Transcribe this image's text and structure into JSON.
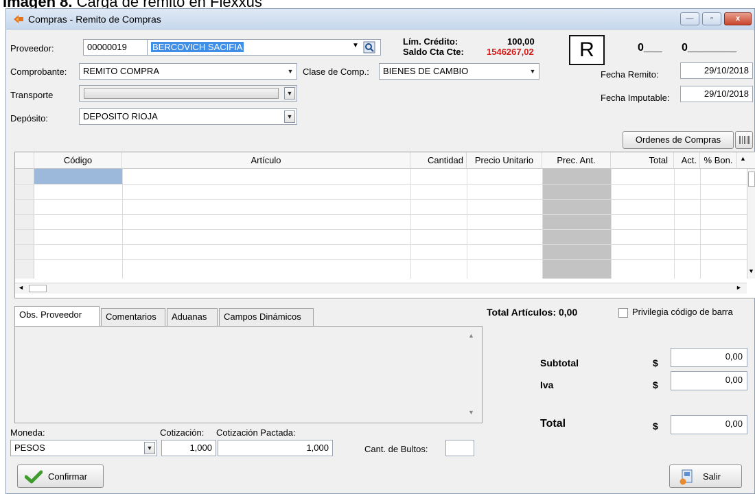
{
  "caption": {
    "bold": "Imagen 8.",
    "rest": " Carga de remito en Flexxus"
  },
  "window": {
    "title": "Compras - Remito de Compras",
    "btn_min": "—",
    "btn_max": "▫",
    "btn_close": "x"
  },
  "header": {
    "proveedor_label": "Proveedor:",
    "proveedor_code": "00000019",
    "proveedor_name": "BERCOVICH SACIFIA",
    "lim_credito_label": "Lím. Crédito:",
    "lim_credito_value": "100,00",
    "saldo_label": "Saldo Cta Cte:",
    "saldo_value": "1546267,02",
    "letter": "R",
    "num1": "0___",
    "num2": "0________",
    "comprobante_label": "Comprobante:",
    "comprobante_value": "REMITO COMPRA",
    "clase_label": "Clase de Comp.:",
    "clase_value": "BIENES DE CAMBIO",
    "fecha_remito_label": "Fecha Remito:",
    "fecha_remito_value": "29/10/2018",
    "transporte_label": "Transporte",
    "transporte_value": "",
    "fecha_imputable_label": "Fecha Imputable:",
    "fecha_imputable_value": "29/10/2018",
    "deposito_label": "Depósito:",
    "deposito_value": "DEPOSITO RIOJA",
    "ordenes_button": "Ordenes de Compras"
  },
  "grid": {
    "columns": [
      "Código",
      "Artículo",
      "Cantidad",
      "Precio Unitario",
      "Prec. Ant.",
      "Total",
      "Act.",
      "% Bon."
    ],
    "rows": []
  },
  "tabs": [
    "Obs. Proveedor",
    "Comentarios",
    "Aduanas",
    "Campos Dinámicos"
  ],
  "totals": {
    "articulos_label": "Total Artículos: 0,00",
    "privilegia_label": "Privilegia código de barra",
    "subtotal_label": "Subtotal",
    "iva_label": "Iva",
    "total_label": "Total",
    "currency": "$",
    "subtotal_value": "0,00",
    "iva_value": "0,00",
    "total_value": "0,00"
  },
  "footer": {
    "moneda_label": "Moneda:",
    "moneda_value": "PESOS",
    "cotizacion_label": "Cotización:",
    "cotizacion_value": "1,000",
    "cot_pactada_label": "Cotización Pactada:",
    "cot_pactada_value": "1,000",
    "bultos_label": "Cant. de Bultos:",
    "bultos_value": "",
    "confirmar_button": "Confirmar",
    "salir_button": "Salir"
  },
  "colors": {
    "accent_blue": "#3f8fe8",
    "saldo_red": "#d11c1c",
    "prec_ant_gray": "#c3c3c3"
  }
}
